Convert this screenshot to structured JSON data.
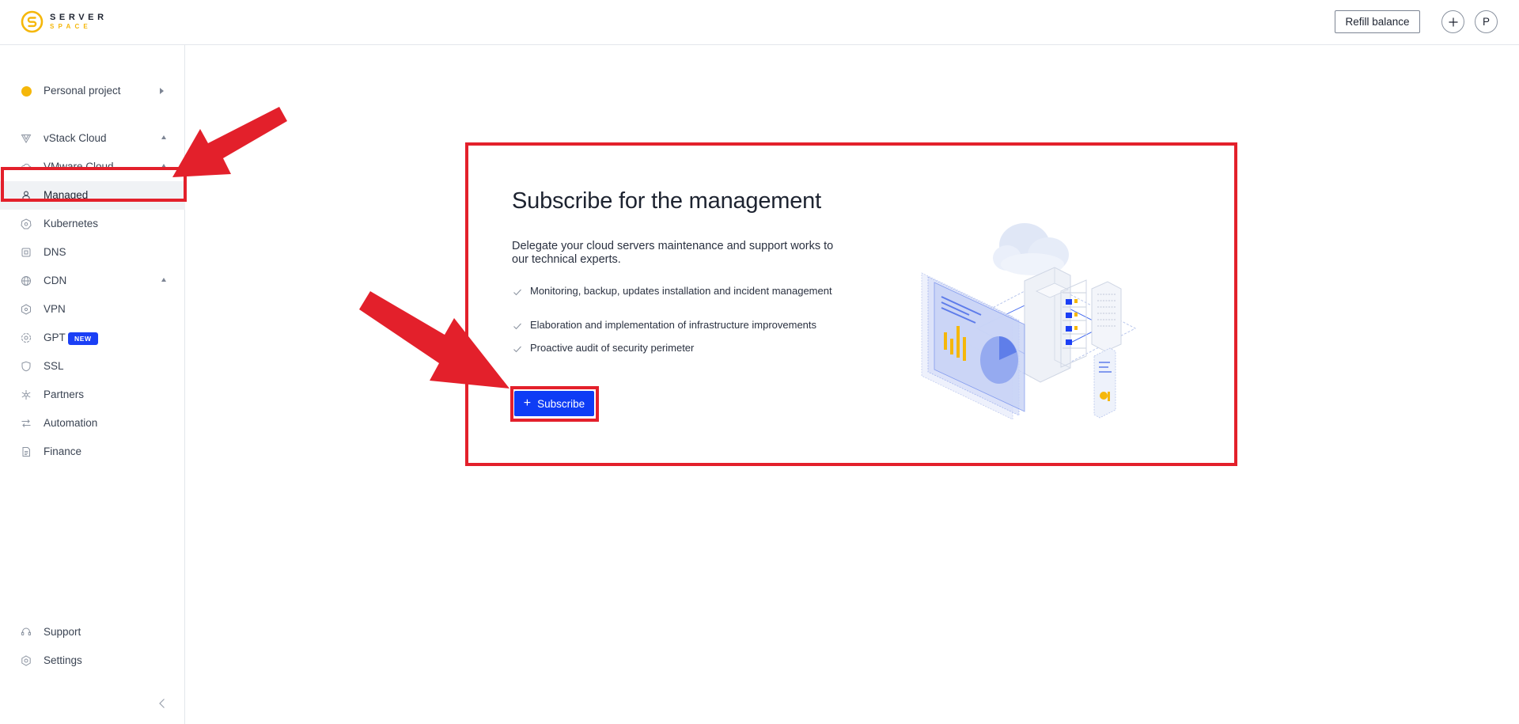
{
  "header": {
    "logo_line1": "SERVER",
    "logo_line2": "SPACE",
    "refill_label": "Refill balance",
    "add_label": "+",
    "avatar_initial": "P"
  },
  "sidebar": {
    "project": {
      "label": "Personal project",
      "icon": "project-dot-icon",
      "color": "#f5b70a"
    },
    "items": [
      {
        "label": "vStack Cloud",
        "icon": "vstack-icon",
        "expandable": true
      },
      {
        "label": "VMware Cloud",
        "icon": "cloud-icon",
        "expandable": true
      },
      {
        "label": "Managed",
        "icon": "managed-icon",
        "active": true
      },
      {
        "label": "Kubernetes",
        "icon": "kubernetes-icon"
      },
      {
        "label": "DNS",
        "icon": "dns-icon"
      },
      {
        "label": "CDN",
        "icon": "globe-icon",
        "expandable": true
      },
      {
        "label": "VPN",
        "icon": "vpn-icon"
      },
      {
        "label": "GPT",
        "icon": "gpt-icon",
        "badge": "NEW"
      },
      {
        "label": "SSL",
        "icon": "shield-icon"
      },
      {
        "label": "Partners",
        "icon": "partners-icon"
      },
      {
        "label": "Automation",
        "icon": "automation-icon"
      },
      {
        "label": "Finance",
        "icon": "finance-icon"
      }
    ],
    "bottom_items": [
      {
        "label": "Support",
        "icon": "support-icon"
      },
      {
        "label": "Settings",
        "icon": "settings-icon"
      }
    ]
  },
  "main": {
    "title": "Subscribe for the management",
    "description": "Delegate your cloud servers maintenance and support works to our technical experts.",
    "features": [
      "Monitoring, backup, updates installation and incident management",
      "Elaboration and implementation of infrastructure improvements",
      "Proactive audit of security perimeter"
    ],
    "subscribe_label": "Subscribe"
  },
  "colors": {
    "accent": "#0e3cf5",
    "highlight": "#e3202b",
    "brand_yellow": "#f5b70a",
    "badge": "#1b3ff5"
  }
}
